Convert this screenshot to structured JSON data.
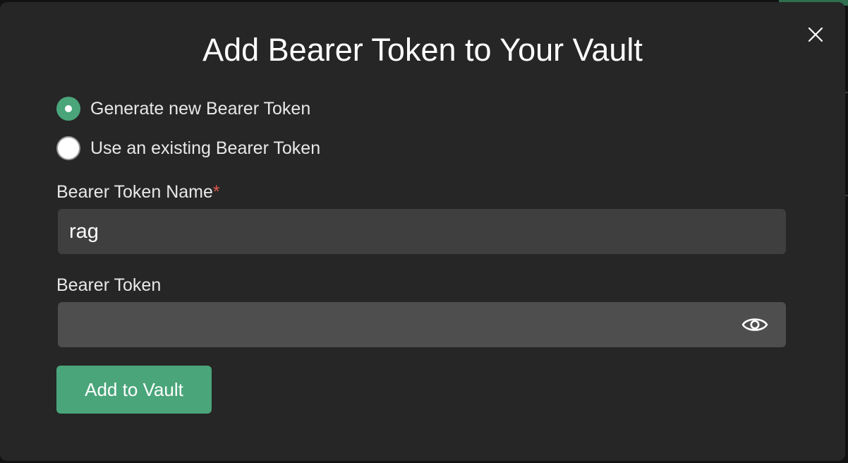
{
  "dialog": {
    "title": "Add Bearer Token to Your Vault",
    "close_icon": "close-icon"
  },
  "token_mode": {
    "options": [
      {
        "label": "Generate new Bearer Token",
        "selected": true
      },
      {
        "label": "Use an existing Bearer Token",
        "selected": false
      }
    ]
  },
  "fields": {
    "name": {
      "label": "Bearer Token Name",
      "required_marker": "*",
      "value": "rag"
    },
    "token": {
      "label": "Bearer Token",
      "value": "",
      "toggle_icon": "eye-icon"
    }
  },
  "actions": {
    "submit_label": "Add to Vault"
  },
  "colors": {
    "accent": "#4aa57a",
    "background": "#262626",
    "required": "#e0574d"
  }
}
